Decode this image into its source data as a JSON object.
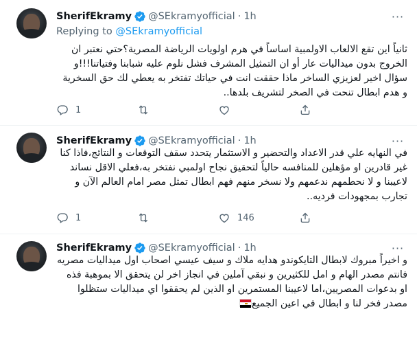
{
  "tweets": [
    {
      "name": "SherifEkramy",
      "handle": "@SEkramyofficial",
      "time": "1h",
      "reply_prefix": "Replying to ",
      "reply_handle": "@SEkramyofficial",
      "text": "ثانياً اين تقع الالعاب الاولمبية اساساً في هرم اولويات الرياضة المصرية؟حتي نعتبر ان الخروج بدون ميداليات عار أو ان التمثيل المشرف فشل نلوم عليه شبابنا وفتياتنا!!!و سؤال اخير لعزيزي الساخر ماذا حققت انت في حياتك تفتخر به يعطي لك حق السخرية و هدم ابطال تنحت في الصخر لتشريف بلدها..",
      "replies": "1",
      "retweets": "",
      "likes": "",
      "icons": [
        "reply-icon",
        "retweet-icon",
        "like-icon",
        "share-icon"
      ]
    },
    {
      "name": "SherifEkramy",
      "handle": "@SEkramyofficial",
      "time": "1h",
      "text": "في النهايه علي قدر الاعداد والتحضير و الاستثمار يتحدد سقف التوقعات و النتائج،فاذا كنا غير قادرين او مؤهلين للمنافسه حالياً لتحقيق نجاح اولمبي نفتخر به،فعلي الاقل نساند لاعيبنا و لا نحطمهم ندعمهم ولا نسخر منهم فهم ابطال تمثل مصر امام العالم الآن و تجارب بمجهودات فرديه..",
      "replies": "1",
      "retweets": "",
      "likes": "146"
    },
    {
      "name": "SherifEkramy",
      "handle": "@SEkramyofficial",
      "time": "1h",
      "text": "و اخيراً مبروك لابطال التايكوندو هدايه ملاك و سيف عيسي اصحاب اول ميداليات مصريه   فانتم مصدر الهام و امل للكثيرين و نبقي آملين في انجاز اخر لن يتحقق الا بموهبة فذه او بدعوات المصريين،اما لاعيبنا المستمرين او الذين لم يحققوا اي ميداليات ستظلوا مصدر فخر لنا و ابطال في اعين الجميع"
    }
  ],
  "colors": {
    "accent": "#1d9bf0",
    "muted": "#536471",
    "text": "#0f1419",
    "divider": "#eff3f4"
  },
  "more_label": "···"
}
